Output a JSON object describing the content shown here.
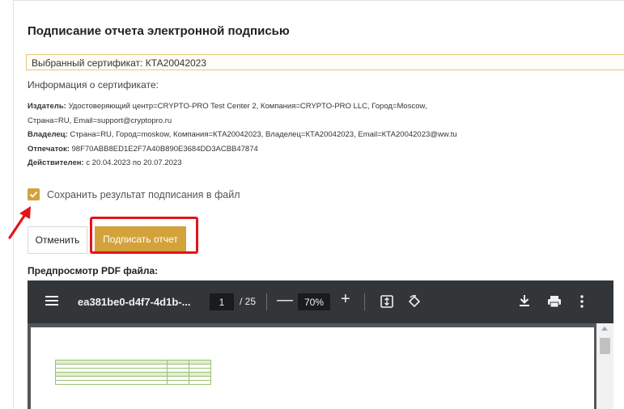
{
  "dialog": {
    "title": "Подписание отчета электронной подписью",
    "certificate_select": "Выбранный сертификат: КТА20042023",
    "info_label": "Информация о сертификате:",
    "info": [
      {
        "key": "Издатель:",
        "value": " Удостоверяющий центр=CRYPTO-PRO Test Center 2, Компания=CRYPTO-PRO LLC, Город=Moscow,"
      },
      {
        "key": "",
        "value": "Страна=RU, Email=support@cryptopro.ru"
      },
      {
        "key": "Владелец:",
        "value": " Страна=RU, Город=moskow, Компания=КТА20042023, Владелец=КТА20042023, Email=КТА20042023@ww.tu"
      },
      {
        "key": "Отпечаток:",
        "value": " 98F70ABB8ED1E2F7A40B890E3684DD3ACBB47874"
      },
      {
        "key": "Действителен:",
        "value": " с 20.04.2023 по 20.07.2023"
      }
    ],
    "save_checkbox_label": "Сохранить результат подписания в файл",
    "save_checkbox_checked": true,
    "cancel_label": "Отменить",
    "sign_label": "Подписать отчет",
    "preview_label": "Предпросмотр PDF файла:"
  },
  "pdf_viewer": {
    "file_name": "ea381be0-d4f7-4d1b-...",
    "current_page": "1",
    "total_pages": "/ 25",
    "zoom": "70%",
    "minus_symbol": "—",
    "plus_symbol": "+",
    "icons": [
      "menu-icon",
      "fit-page-icon",
      "rotate-icon",
      "download-icon",
      "print-icon",
      "more-icon"
    ]
  },
  "colors": {
    "accent": "#d4a23b",
    "highlight": "#e3141b",
    "toolbar": "#323639"
  }
}
